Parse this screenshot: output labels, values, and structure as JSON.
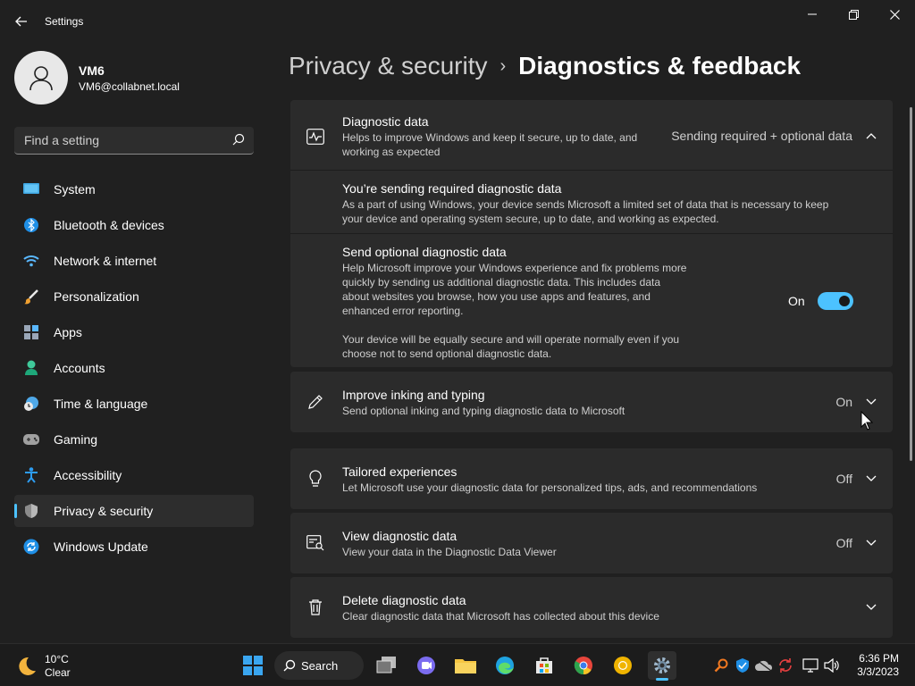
{
  "window": {
    "title": "Settings"
  },
  "profile": {
    "name": "VM6",
    "email": "VM6@collabnet.local"
  },
  "search": {
    "placeholder": "Find a setting"
  },
  "nav": [
    {
      "label": "System",
      "icon": "monitor-icon"
    },
    {
      "label": "Bluetooth & devices",
      "icon": "bluetooth-icon"
    },
    {
      "label": "Network & internet",
      "icon": "wifi-icon"
    },
    {
      "label": "Personalization",
      "icon": "brush-icon"
    },
    {
      "label": "Apps",
      "icon": "apps-icon"
    },
    {
      "label": "Accounts",
      "icon": "person-icon"
    },
    {
      "label": "Time & language",
      "icon": "clock-globe-icon"
    },
    {
      "label": "Gaming",
      "icon": "gamepad-icon"
    },
    {
      "label": "Accessibility",
      "icon": "accessibility-icon"
    },
    {
      "label": "Privacy & security",
      "icon": "shield-icon",
      "active": true
    },
    {
      "label": "Windows Update",
      "icon": "update-icon"
    }
  ],
  "breadcrumb": {
    "parent": "Privacy & security",
    "current": "Diagnostics & feedback"
  },
  "diagnostic": {
    "title": "Diagnostic data",
    "desc_line1": "Helps to improve Windows and keep it secure, up to date, and",
    "desc_line2": "working as expected",
    "value": "Sending required + optional data",
    "required": {
      "title": "You’re sending required diagnostic data",
      "desc_line1": "As a part of using Windows, your device sends Microsoft a limited set of data that is necessary to keep",
      "desc_line2": "your device and operating system secure, up to date, and working as expected."
    },
    "optional": {
      "title": "Send optional diagnostic data",
      "desc_line1": "Help Microsoft improve your Windows experience and fix problems more",
      "desc_line2": "quickly by sending us additional diagnostic data. This includes data",
      "desc_line3": "about websites you browse, how you use apps and features, and",
      "desc_line4": "enhanced error reporting.",
      "note_line1": "Your device will be equally secure and will operate normally even if you",
      "note_line2": "choose not to send optional diagnostic data.",
      "toggle_label": "On",
      "toggle_on": true
    }
  },
  "inking": {
    "title": "Improve inking and typing",
    "desc": "Send optional inking and typing diagnostic data to Microsoft",
    "value": "On"
  },
  "tailored": {
    "title": "Tailored experiences",
    "desc": "Let Microsoft use your diagnostic data for personalized tips, ads, and recommendations",
    "value": "Off"
  },
  "viewdata": {
    "title": "View diagnostic data",
    "desc": "View your data in the Diagnostic Data Viewer",
    "value": "Off"
  },
  "deletedata": {
    "title": "Delete diagnostic data",
    "desc": "Clear diagnostic data that Microsoft has collected about this device"
  },
  "taskbar": {
    "weather_temp": "10°C",
    "weather_cond": "Clear",
    "search_label": "Search",
    "time": "6:36 PM",
    "date": "3/3/2023"
  },
  "colors": {
    "accent": "#4cc2ff",
    "background": "#202020",
    "card": "#2b2b2b"
  }
}
